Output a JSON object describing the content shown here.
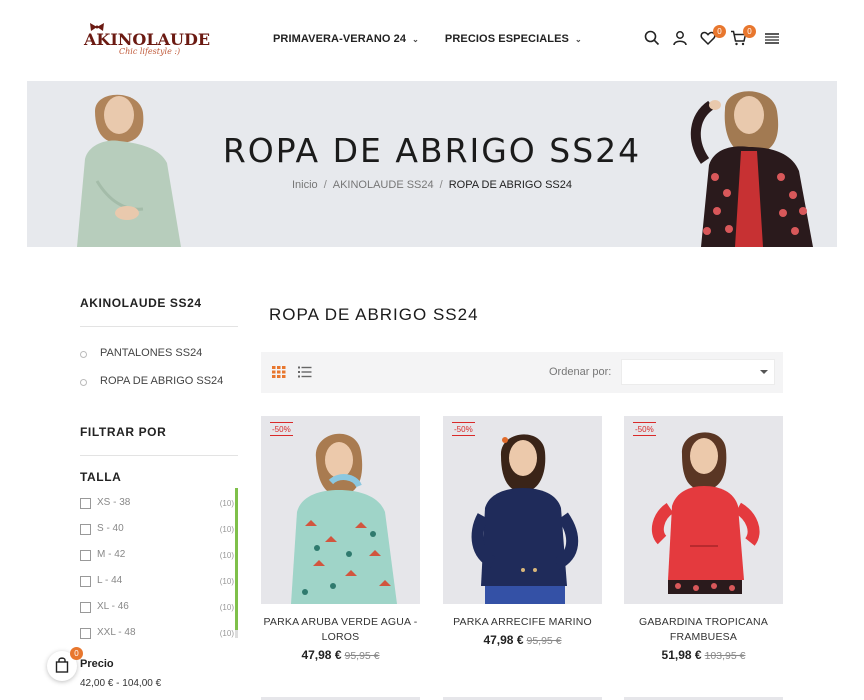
{
  "header": {
    "logo_text": "AKINOLAUDE",
    "logo_tagline": "Chic lifestyle :)",
    "nav": [
      {
        "label": "PRIMAVERA-VERANO 24"
      },
      {
        "label": "PRECIOS ESPECIALES"
      }
    ],
    "wishlist_count": "0",
    "cart_count": "0",
    "icons": [
      "search-icon",
      "user-icon",
      "heart-icon",
      "cart-icon",
      "menu-icon"
    ]
  },
  "hero": {
    "title": "ROPA DE ABRIGO SS24",
    "breadcrumb": [
      "Inicio",
      "AKINOLAUDE SS24",
      "ROPA DE ABRIGO SS24"
    ]
  },
  "sidebar": {
    "category_title": "AKINOLAUDE SS24",
    "categories": [
      "PANTALONES SS24",
      "ROPA DE ABRIGO SS24"
    ],
    "filter_title": "FILTRAR POR",
    "size_title": "TALLA",
    "sizes": [
      {
        "label": "XS - 38",
        "count": "(10)"
      },
      {
        "label": "S - 40",
        "count": "(10)"
      },
      {
        "label": "M - 42",
        "count": "(10)"
      },
      {
        "label": "L - 44",
        "count": "(10)"
      },
      {
        "label": "XL - 46",
        "count": "(10)"
      },
      {
        "label": "XXL - 48",
        "count": "(10)"
      }
    ],
    "price_title": "Precio",
    "price_range": "42,00 € - 104,00 €"
  },
  "floating_cart": {
    "count": "0"
  },
  "main": {
    "title": "ROPA DE ABRIGO SS24",
    "sort_label": "Ordenar por:",
    "sort_value": "",
    "products": [
      {
        "discount": "-50%",
        "name": "PARKA ARUBA VERDE AGUA - LOROS",
        "price": "47,98 €",
        "old_price": "95,95 €"
      },
      {
        "discount": "-50%",
        "name": "PARKA ARRECIFE MARINO",
        "price": "47,98 €",
        "old_price": "95,95 €"
      },
      {
        "discount": "-50%",
        "name": "GABARDINA TROPICANA FRAMBUESA",
        "price": "51,98 €",
        "old_price": "103,95 €"
      }
    ]
  },
  "colors": {
    "accent": "#e8772e",
    "discount": "#d92a2a",
    "hero_bg": "#e7e9ed",
    "scroll_thumb": "#7fc04a"
  }
}
